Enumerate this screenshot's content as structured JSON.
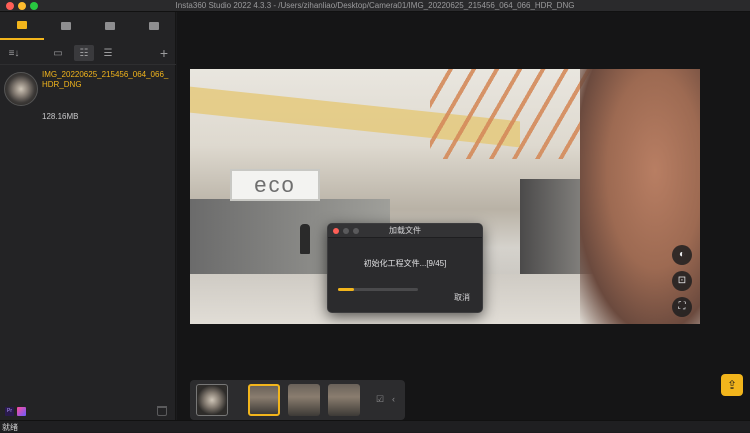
{
  "window": {
    "title": "Insta360 Studio 2022 4.3.3 - /Users/zihanliao/Desktop/Camera01/IMG_20220625_215456_064_066_HDR_DNG"
  },
  "sidebar": {
    "tabs": [
      {
        "icon": "monitor-icon"
      },
      {
        "icon": "folder-icon"
      },
      {
        "icon": "folder-star-icon"
      },
      {
        "icon": "document-edit-icon"
      }
    ],
    "toolbar": {
      "sort_label": "≡↓",
      "view_single": "▭",
      "view_grid": "☷",
      "view_list": "☰",
      "add": "+"
    },
    "files": [
      {
        "name": "IMG_20220625_215456_064_066_HDR_DNG",
        "size": "128.16MB"
      }
    ],
    "badges": {
      "premiere": "Pr"
    }
  },
  "viewer": {
    "store_sign": "eco",
    "controls": {
      "gyro": "◐",
      "fit": "⊡",
      "fullscreen": "⛶"
    }
  },
  "dialog": {
    "title": "加载文件",
    "message": "初始化工程文件...[9/45]",
    "progress": 0.2,
    "cancel": "取消"
  },
  "timeline": {
    "frames": 4,
    "selected_index": 1,
    "icons": {
      "edit": "☑",
      "collapse": "‹"
    }
  },
  "export": {
    "icon": "⇪"
  },
  "status": {
    "text": "就绪"
  },
  "colors": {
    "accent": "#f2b51c"
  }
}
